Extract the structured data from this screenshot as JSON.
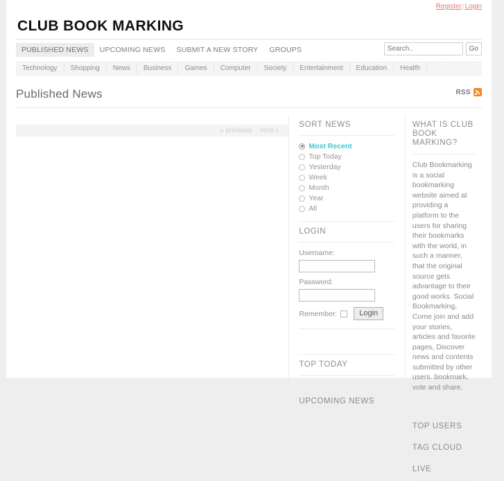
{
  "topbar": {
    "register": "Register",
    "separator": "|",
    "login": "Login"
  },
  "site": {
    "logo": "CLUB BOOK MARKING"
  },
  "mainnav": {
    "items": [
      {
        "label": "PUBLISHED NEWS",
        "active": true
      },
      {
        "label": "UPCOMING NEWS",
        "active": false
      },
      {
        "label": "SUBMIT A NEW STORY",
        "active": false
      },
      {
        "label": "GROUPS",
        "active": false
      }
    ]
  },
  "search": {
    "value": "",
    "placeholder": "Search..",
    "button_label": "Go"
  },
  "categories": [
    "Technology",
    "Shopping",
    "News",
    "Business",
    "Games",
    "Computer",
    "Society",
    "Entertainment",
    "Education",
    "Health"
  ],
  "page": {
    "title": "Published News",
    "rss_label": "RSS"
  },
  "pager": {
    "previous": "« previous",
    "next": "next »"
  },
  "sort_news": {
    "title": "SORT NEWS",
    "options": [
      {
        "label": "Most Recent",
        "selected": true
      },
      {
        "label": "Top Today",
        "selected": false
      },
      {
        "label": "Yesterday",
        "selected": false
      },
      {
        "label": "Week",
        "selected": false
      },
      {
        "label": "Month",
        "selected": false
      },
      {
        "label": "Year",
        "selected": false
      },
      {
        "label": "All",
        "selected": false
      }
    ]
  },
  "login_box": {
    "title": "LOGIN",
    "username_label": "Username:",
    "username_value": "",
    "password_label": "Password:",
    "password_value": "",
    "remember_label": "Remember:",
    "submit_label": "Login"
  },
  "top_today": {
    "title": "TOP TODAY"
  },
  "upcoming_news": {
    "title": "UPCOMING NEWS"
  },
  "about": {
    "title": "WHAT IS CLUB BOOK MARKING?",
    "body": "Club Bookmarking is a social bookmarking website aimed at providing a platform to the users for sharing their bookmarks with the world, in such a manner, that the original source gets advantage to their good works. Social Bookmarking, Come join and add your stories, articles and favorite pages, Discover news and contents submitted by other users. bookmark, vote and share."
  },
  "top_users": {
    "title": "TOP USERS"
  },
  "tag_cloud": {
    "title": "TAG CLOUD"
  },
  "live": {
    "title": "LIVE"
  },
  "colors": {
    "accent_teal": "#3bc8d4",
    "link_red": "#e07b7b",
    "rss_orange": "#f08a24",
    "page_bg": "#eeeeee",
    "content_bg": "#ffffff"
  }
}
